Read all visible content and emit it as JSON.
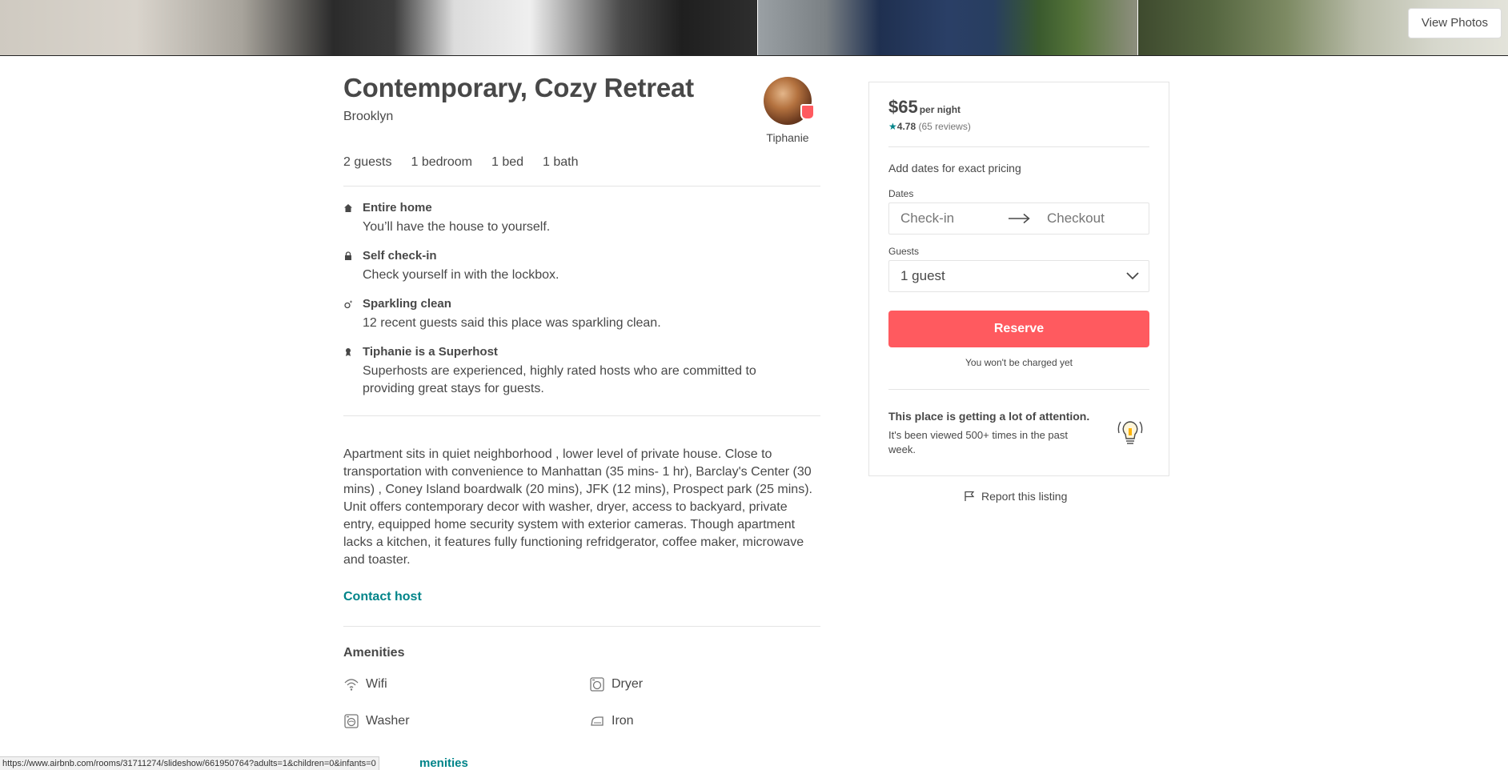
{
  "hero": {
    "view_photos_label": "View Photos"
  },
  "listing": {
    "title": "Contemporary, Cozy Retreat",
    "city": "Brooklyn",
    "host_name": "Tiphanie",
    "facts": [
      "2 guests",
      "1 bedroom",
      "1 bed",
      "1 bath"
    ],
    "highlights": [
      {
        "icon": "home-icon",
        "title": "Entire home",
        "desc": "You’ll have the house to yourself."
      },
      {
        "icon": "lock-icon",
        "title": "Self check-in",
        "desc": "Check yourself in with the lockbox."
      },
      {
        "icon": "sparkle-icon",
        "title": "Sparkling clean",
        "desc": "12 recent guests said this place was sparkling clean."
      },
      {
        "icon": "medal-icon",
        "title": "Tiphanie is a Superhost",
        "desc": "Superhosts are experienced, highly rated hosts who are committed to providing great stays for guests."
      }
    ],
    "description": "Apartment sits in quiet neighborhood , lower level of private house. Close to transportation with convenience to Manhattan (35 mins- 1 hr), Barclay's Center (30 mins) , Coney Island boardwalk (20 mins), JFK (12 mins), Prospect park (25 mins). Unit offers contemporary decor with washer, dryer, access to backyard, private entry, equipped home security system with exterior cameras. Though apartment lacks a kitchen, it features fully functioning refridgerator, coffee maker, microwave and toaster.",
    "contact_host_label": "Contact host",
    "amenities_title": "Amenities",
    "amenities": [
      {
        "icon": "wifi-icon",
        "label": "Wifi"
      },
      {
        "icon": "dryer-icon",
        "label": "Dryer"
      },
      {
        "icon": "washer-icon",
        "label": "Washer"
      },
      {
        "icon": "iron-icon",
        "label": "Iron"
      }
    ]
  },
  "booking": {
    "price": "$65",
    "price_unit": "per night",
    "star": "★",
    "rating": "4.78",
    "reviews": "(65 reviews)",
    "pricing_note": "Add dates for exact pricing",
    "dates_label": "Dates",
    "checkin_placeholder": "Check-in",
    "checkout_placeholder": "Checkout",
    "guests_label": "Guests",
    "guests_value": "1 guest",
    "reserve_label": "Reserve",
    "not_charged": "You won't be charged yet",
    "attention_title": "This place is getting a lot of attention.",
    "attention_text": "It's been viewed 500+ times in the past week.",
    "report_label": "Report this listing",
    "accent_color": "#ff5a5f",
    "link_color": "#008489"
  },
  "status_bar": {
    "url": "https://www.airbnb.com/rooms/31711274/slideshow/661950764?adults=1&children=0&infants=0",
    "partial_link": "menities"
  }
}
